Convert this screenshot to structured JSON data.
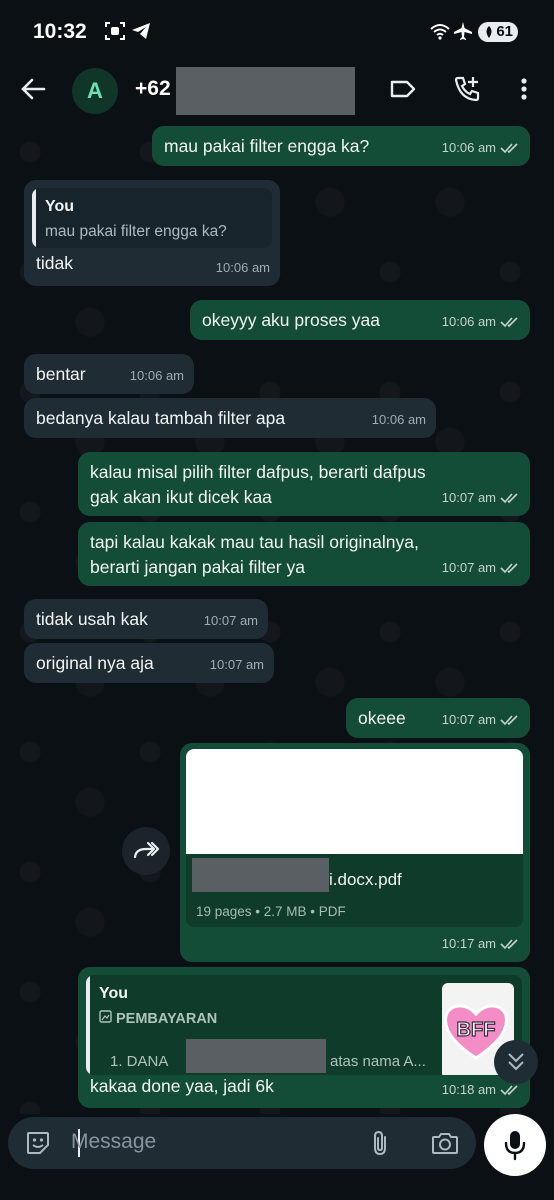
{
  "status_bar": {
    "time": "10:32",
    "battery": "61"
  },
  "header": {
    "avatar_letter": "A",
    "contact_prefix": "+62"
  },
  "messages": [
    {
      "text": "mau pakai filter engga ka?",
      "time": "10:06 am"
    },
    {
      "quote_author": "You",
      "quote_text": "mau pakai filter engga ka?",
      "text": "tidak",
      "time": "10:06 am"
    },
    {
      "text": "okeyyy aku proses yaa",
      "time": "10:06 am"
    },
    {
      "text": "bentar",
      "time": "10:06 am"
    },
    {
      "text": "bedanya kalau tambah filter apa",
      "time": "10:06 am"
    },
    {
      "line1": "kalau misal pilih filter dafpus, berarti dafpus",
      "line2": "gak akan ikut dicek kaa",
      "time": "10:07 am"
    },
    {
      "line1": "tapi kalau kakak mau tau hasil originalnya,",
      "line2": "berarti jangan pakai filter ya",
      "time": "10:07 am"
    },
    {
      "text": "tidak usah kak",
      "time": "10:07 am"
    },
    {
      "text": "original nya aja",
      "time": "10:07 am"
    },
    {
      "text": "okeee",
      "time": "10:07 am"
    },
    {
      "doc_name_suffix": "i.docx.pdf",
      "doc_info": "19 pages • 2.7 MB • PDF",
      "time": "10:17 am"
    },
    {
      "quote_author": "You",
      "quote_label": "PEMBAYARAN",
      "quote_line_start": "1. DANA",
      "quote_line_end": "atas nama A...",
      "text": "kakaa done yaa, jadi 6k",
      "time": "10:18 am"
    }
  ],
  "sticker_text": "BFF",
  "composer": {
    "placeholder": "Message"
  },
  "colors": {
    "outgoing": "#134d37",
    "incoming": "#1f2c34",
    "background": "#0b1014"
  },
  "icons": [
    "back-arrow-icon",
    "label-icon",
    "add-call-icon",
    "more-vert-icon",
    "forward-icon",
    "emoji-icon",
    "attach-icon",
    "camera-icon",
    "mic-icon",
    "double-check-icon"
  ]
}
